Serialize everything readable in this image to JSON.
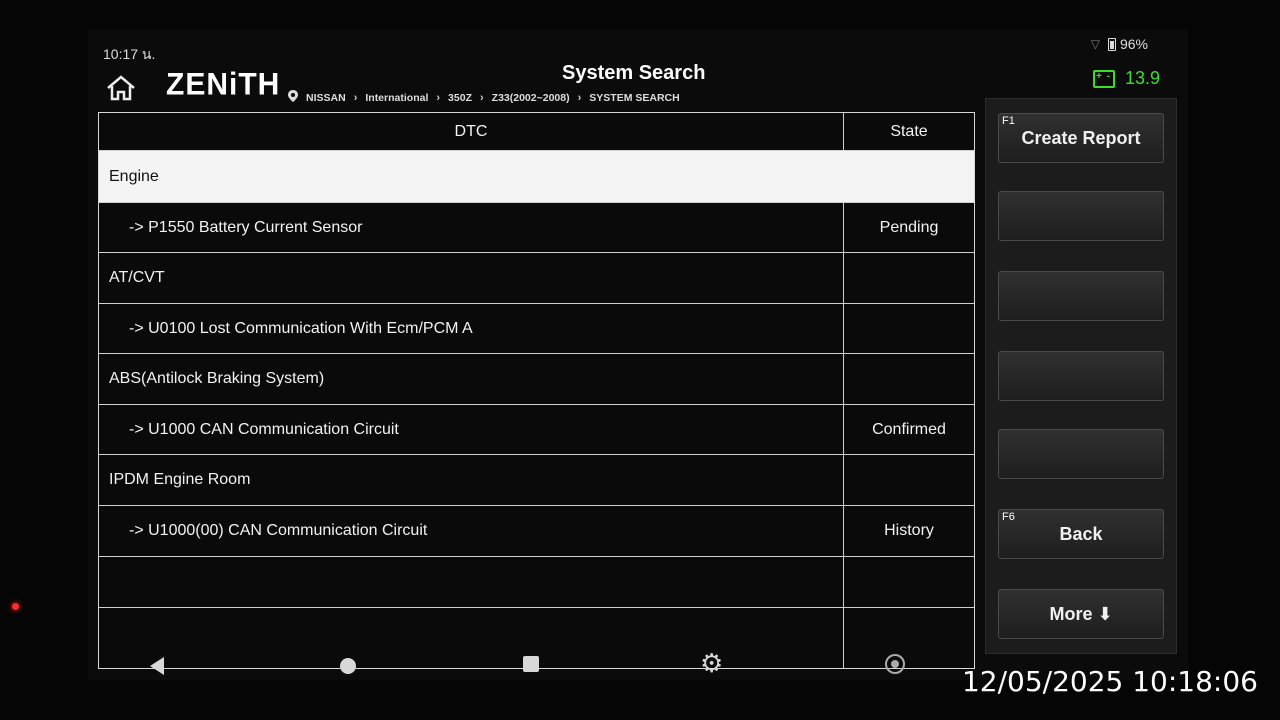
{
  "status_bar": {
    "time": "10:17 น.",
    "battery": "96%"
  },
  "header": {
    "logo": "ZENiTH",
    "title": "System Search",
    "breadcrumb": [
      "NISSAN",
      "International",
      "350Z",
      "Z33(2002~2008)",
      "SYSTEM SEARCH"
    ],
    "voltage": "13.9"
  },
  "table": {
    "columns": [
      "DTC",
      "State"
    ],
    "rows": [
      {
        "dtc": "Engine",
        "state": ""
      },
      {
        "dtc": "->  P1550 Battery Current Sensor",
        "state": "Pending"
      },
      {
        "dtc": "AT/CVT",
        "state": ""
      },
      {
        "dtc": "->  U0100 Lost Communication With Ecm/PCM A",
        "state": ""
      },
      {
        "dtc": "ABS(Antilock Braking System)",
        "state": ""
      },
      {
        "dtc": "->  U1000 CAN Communication Circuit",
        "state": "Confirmed"
      },
      {
        "dtc": "IPDM Engine Room",
        "state": ""
      },
      {
        "dtc": "->  U1000(00) CAN Communication Circuit",
        "state": "History"
      },
      {
        "dtc": "",
        "state": ""
      },
      {
        "dtc": "",
        "state": ""
      }
    ]
  },
  "side_buttons": [
    {
      "fkey": "F1",
      "label": "Create Report"
    },
    {
      "fkey": "",
      "label": ""
    },
    {
      "fkey": "",
      "label": ""
    },
    {
      "fkey": "",
      "label": ""
    },
    {
      "fkey": "",
      "label": ""
    },
    {
      "fkey": "F6",
      "label": "Back"
    },
    {
      "fkey": "",
      "label": "More ⬇"
    }
  ],
  "timestamp": "12/05/2025 10:18:06",
  "colors": {
    "voltage": "#3ddc2c",
    "selected_row": "#f4f4f4",
    "background": "#0b0b0b"
  }
}
